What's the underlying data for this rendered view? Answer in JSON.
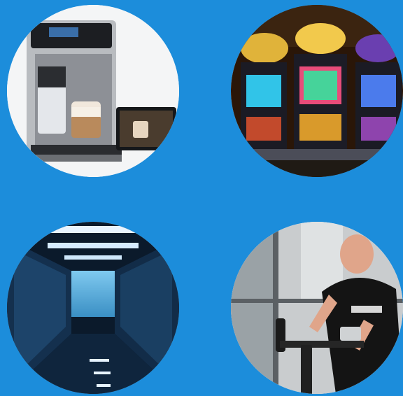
{
  "tiles": [
    {
      "icon": "coffee-machine-icon"
    },
    {
      "icon": "slot-machines-icon"
    },
    {
      "icon": "data-center-icon"
    },
    {
      "icon": "exercise-bike-icon"
    }
  ],
  "colors": {
    "background": "#1c8ddb",
    "tile_edge": "#ffffff"
  }
}
